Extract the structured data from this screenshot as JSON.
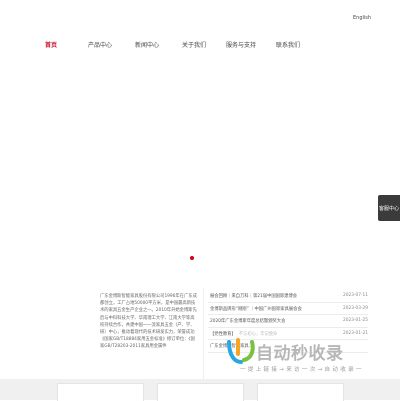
{
  "header": {
    "language_link": "English"
  },
  "nav": {
    "items": [
      {
        "label": "首页",
        "active": true
      },
      {
        "label": "产品中心",
        "active": false
      },
      {
        "label": "新闻中心",
        "active": false
      },
      {
        "label": "关于我们",
        "active": false
      },
      {
        "label": "服务与支持",
        "active": false
      },
      {
        "label": "联系我们",
        "active": false
      }
    ]
  },
  "side_tab": {
    "label": "客服中心"
  },
  "about": {
    "text": "广东金博斯智能家具股份有限公司1996年在广东成都创立，工厂占地50000平方米，是中国最高新技术的家具五金生产企业之一。2010年开始金博斯先后与中科科技大学、华南理工大学、江南大学等高校持续合作，共建中国一一流家具五金（产、学、研）中心，推动着现代的技术研发实力，荣誉成功《国家GB/T18884家用五金标准》修订单位：《国家GB/T28203-2011家具用金属件"
  },
  "news": {
    "items": [
      {
        "title": "展会回顾｜来自万科｜第21届中国国际建博会",
        "date": "2023-07-11",
        "sub": ""
      },
      {
        "title": "金博斯品牌形“刚刚” ｜中国广州国际家具展会会",
        "date": "2023-03-29",
        "sub": ""
      },
      {
        "title": "2020年广东金博斯年度总结暨颁奖大会",
        "date": "2023-01-25",
        "sub": ""
      },
      {
        "title": "【党性教育】",
        "date": "2023-01-21",
        "sub": "不忘初心，牢记使命"
      },
      {
        "title": "广东金博斯智能家具...",
        "date": "",
        "sub": ""
      }
    ]
  },
  "watermark": {
    "name": "自动秒收录",
    "tagline": "一 提 上 链 接 → 来 访 一 次 → 自 动 收 录 一"
  },
  "colors": {
    "accent": "#c8102e",
    "slider_dot": "#d0021b",
    "side_tab_bg": "#3b3b3b",
    "bottom_band": "#f0f0f0"
  }
}
